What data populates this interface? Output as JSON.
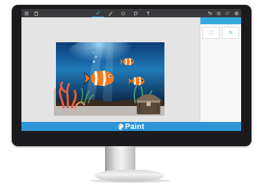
{
  "app": {
    "brand_text": "Paint",
    "accent_color": "#36a9e1",
    "banner_color": "#2d96d6"
  },
  "toolbar": {
    "left_icons": [
      "menu-icon",
      "paste-icon"
    ],
    "center_icons": [
      "brush-icon",
      "pen-icon",
      "shape-3d-icon",
      "stickers-icon",
      "text-icon"
    ],
    "active_tool": "brush-icon",
    "right_icons": [
      "undo-icon",
      "history-icon",
      "redo-icon",
      "settings-icon"
    ]
  },
  "panel": {
    "title": "",
    "tools": [
      {
        "icon": "select-icon",
        "label": ""
      },
      {
        "icon": "crop-icon",
        "label": ""
      }
    ]
  },
  "canvas": {
    "image": "aquarium-clownfish-illustration",
    "sticker": "treasure-chest-3d-model"
  }
}
